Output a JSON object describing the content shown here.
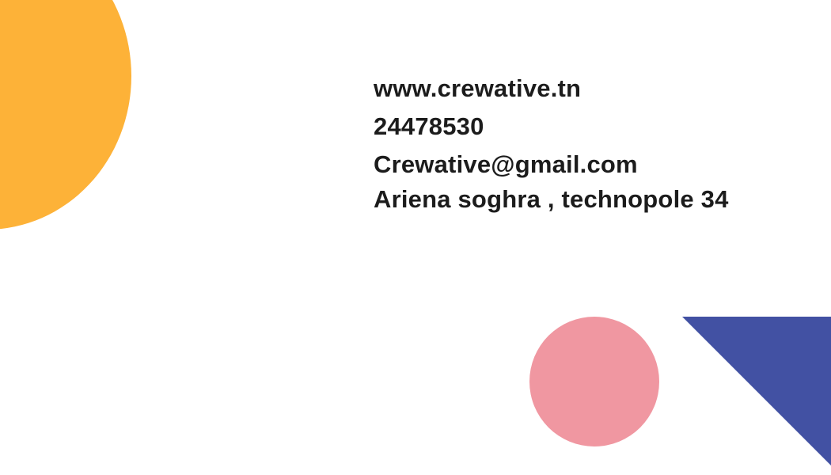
{
  "contact": {
    "website": "www.crewative.tn",
    "phone": "24478530",
    "email": "Crewative@gmail.com",
    "address": "Ariena soghra , technopole 34"
  },
  "colors": {
    "yellow_circle": "#FDB238",
    "pink_circle": "#F097A1",
    "blue_triangle": "#4251A3",
    "text": "#1C1C1C",
    "background": "#FFFFFF"
  }
}
